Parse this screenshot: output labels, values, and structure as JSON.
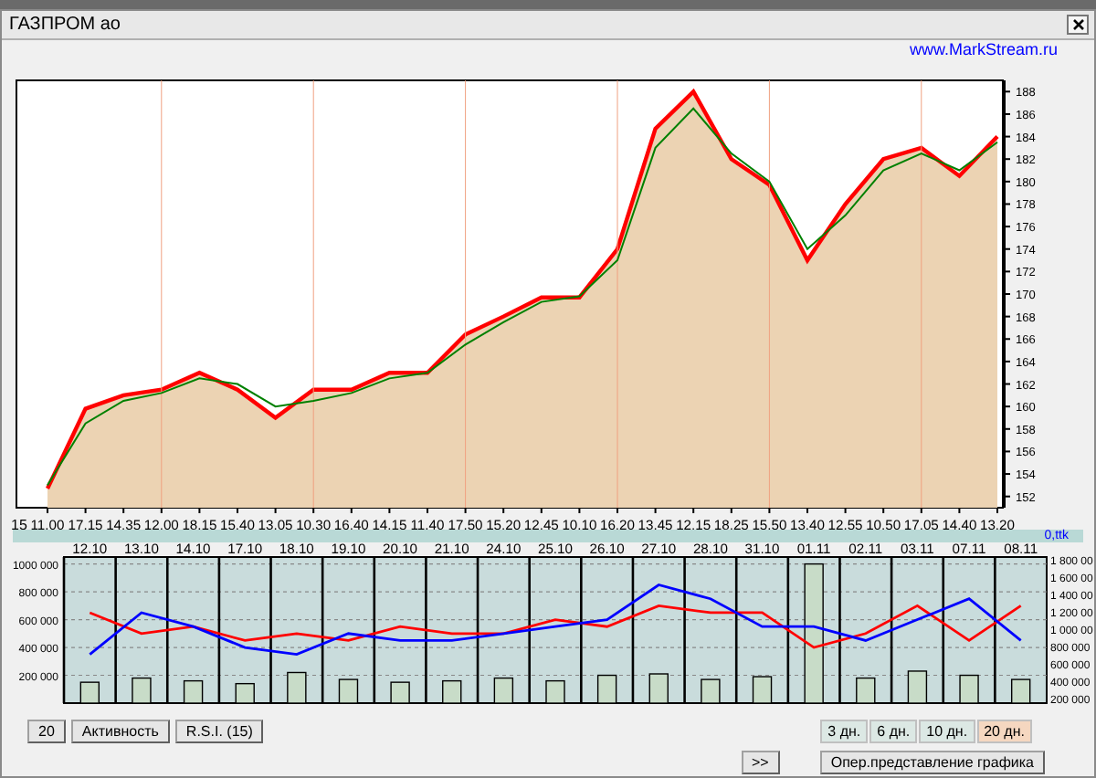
{
  "window": {
    "title": "ГАЗПРОМ ао",
    "link": "www.MarkStream.ru"
  },
  "main_chart": {
    "leading_label": "15",
    "chart_data": {
      "type": "area",
      "categories": [
        "11.00",
        "17.15",
        "14.35",
        "12.00",
        "18.15",
        "15.40",
        "13.05",
        "10.30",
        "16.40",
        "14.15",
        "11.40",
        "17.50",
        "15.20",
        "12.45",
        "10.10",
        "16.20",
        "13.45",
        "12.15",
        "18.25",
        "15.50",
        "13.40",
        "12.55",
        "10.50",
        "17.05",
        "14.40",
        "13.20"
      ],
      "grid": true,
      "series": [
        {
          "color": "#ff0000",
          "values": [
            152.7,
            159.8,
            161,
            161.5,
            163,
            161.5,
            159,
            161.5,
            161.5,
            163,
            163,
            166.4,
            168,
            169.7,
            169.7,
            174,
            184.7,
            188,
            182,
            179.7,
            173,
            178,
            182,
            183,
            180.5,
            184
          ]
        },
        {
          "type": "line",
          "color": "#008000",
          "values": [
            153,
            158.5,
            160.5,
            161.2,
            162.5,
            162,
            160,
            160.5,
            161.2,
            162.5,
            163,
            165.5,
            167.5,
            169.3,
            169.8,
            173,
            183,
            186.5,
            182.5,
            180,
            174,
            177,
            181,
            182.5,
            181,
            183.5
          ]
        }
      ],
      "ylim": [
        151,
        189
      ],
      "yticks": [
        152,
        154,
        156,
        158,
        160,
        162,
        164,
        166,
        168,
        170,
        172,
        174,
        176,
        178,
        180,
        182,
        184,
        186,
        188
      ]
    }
  },
  "strip": {
    "label": "0,ttk"
  },
  "lower_chart": {
    "right_labels": [
      "1 800 00",
      "1 600 00",
      "1 400 00",
      "1 200 00",
      "1 000 00",
      "800 000",
      "600 000",
      "400 000",
      "200 000"
    ],
    "chart_data": {
      "type": "line",
      "categories": [
        "12.10",
        "13.10",
        "14.10",
        "17.10",
        "18.10",
        "19.10",
        "20.10",
        "21.10",
        "24.10",
        "25.10",
        "26.10",
        "27.10",
        "28.10",
        "31.10",
        "01.11",
        "02.11",
        "03.11",
        "07.11",
        "08.11"
      ],
      "grid": true,
      "series": [
        {
          "color": "#ff0000",
          "values": [
            650000,
            500000,
            550000,
            450000,
            500000,
            450000,
            550000,
            500000,
            500000,
            600000,
            550000,
            700000,
            650000,
            650000,
            400000,
            500000,
            700000,
            450000,
            700000
          ]
        },
        {
          "color": "#0000ff",
          "values": [
            350000,
            650000,
            550000,
            400000,
            350000,
            500000,
            450000,
            450000,
            500000,
            550000,
            600000,
            850000,
            750000,
            550000,
            550000,
            450000,
            600000,
            750000,
            450000
          ]
        },
        {
          "type": "bar",
          "color": "#c8dcc8",
          "values": [
            150000,
            180000,
            160000,
            140000,
            220000,
            170000,
            150000,
            160000,
            180000,
            160000,
            200000,
            210000,
            170000,
            190000,
            1000000,
            180000,
            230000,
            200000,
            170000
          ]
        }
      ],
      "ylim": [
        0,
        1050000
      ],
      "yticks": [
        {
          "value": 200000,
          "label": "200 000"
        },
        {
          "value": 400000,
          "label": "400 000"
        },
        {
          "value": 600000,
          "label": "600 000"
        },
        {
          "value": 800000,
          "label": "800 000"
        },
        {
          "value": 1000000,
          "label": "1000 000"
        }
      ]
    }
  },
  "buttons": [
    {
      "label": "20"
    },
    {
      "label": "Активность"
    },
    {
      "label": "R.S.I. (15)"
    }
  ],
  "periods": [
    {
      "label": "3 дн.",
      "selected": false
    },
    {
      "label": "6 дн.",
      "selected": false
    },
    {
      "label": "10 дн.",
      "selected": false
    },
    {
      "label": "20 дн.",
      "selected": true
    }
  ],
  "scroll_button": ">>",
  "mode_button": "Опер.представление графика"
}
